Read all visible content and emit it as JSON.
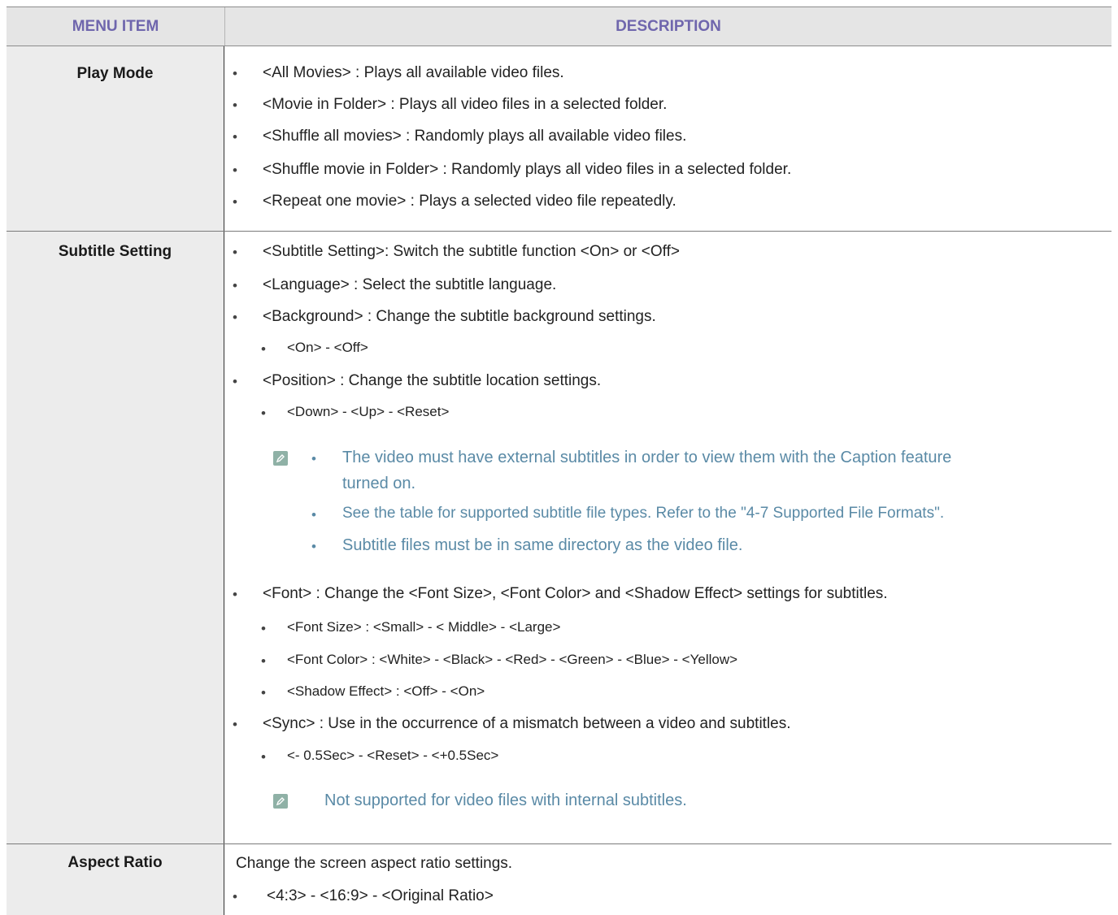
{
  "header": {
    "col1": "MENU ITEM",
    "col2": "DESCRIPTION"
  },
  "play_mode": {
    "label": "Play Mode",
    "items": [
      "<All Movies> : Plays all available video files.",
      "<Movie in Folder> : Plays all video files in a selected folder.",
      "<Shuffle all movies> : Randomly plays all available video files.",
      "<Shuffle movie in Folder> : Randomly plays all video files in a selected folder.",
      "<Repeat one movie> : Plays a selected video file repeatedly."
    ]
  },
  "subtitle_setting": {
    "label": "Subtitle Setting",
    "items": [
      "<Subtitle Setting>: Switch the subtitle function <On> or <Off>",
      "<Language> : Select the subtitle language.",
      "<Background> : Change the subtitle background settings.",
      "<On> - <Off>",
      "<Position> : Change the subtitle location settings.",
      "<Down> - <Up> - <Reset>"
    ],
    "notes": [
      "The video must have external subtitles in order to view them with the Caption feature",
      "turned on.",
      "See the table for supported subtitle file types. Refer to the \"4-7 Supported File Formats\".",
      "Subtitle files must be in same directory as the video file."
    ],
    "font_items": [
      "<Font> : Change the <Font Size>, <Font Color> and <Shadow Effect> settings for subtitles.",
      "<Font Size> : <Small> - < Middle> - <Large>",
      "<Font Color> : <White> - <Black> - <Red> - <Green> - <Blue> - <Yellow>",
      "<Shadow Effect> : <Off> - <On>",
      "<Sync> : Use in the occurrence of a mismatch between a video and subtitles.",
      "<- 0.5Sec> - <Reset> - <+0.5Sec>"
    ],
    "sync_note": "Not supported for video files with internal subtitles."
  },
  "aspect_ratio": {
    "label": "Aspect Ratio",
    "intro": "Change the screen aspect ratio settings.",
    "items": [
      "<4:3> - <16:9> - <Original Ratio>"
    ]
  },
  "bullet": "•",
  "icons": {
    "note": "pencil-note-icon"
  },
  "colors": {
    "header_text": "#6f66ad",
    "note_text": "#5a8aa6",
    "label_bg": "#ececec",
    "header_bg": "#e5e5e5"
  }
}
